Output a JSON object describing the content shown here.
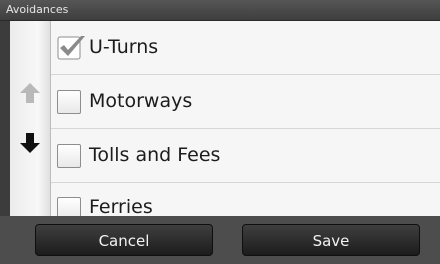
{
  "title": "Avoidances",
  "scroll": {
    "up_icon": "arrow-up-icon",
    "down_icon": "arrow-down-icon",
    "up_enabled": false,
    "down_enabled": true
  },
  "items": [
    {
      "label": "U-Turns",
      "checked": true
    },
    {
      "label": "Motorways",
      "checked": false
    },
    {
      "label": "Tolls and Fees",
      "checked": false
    },
    {
      "label": "Ferries",
      "checked": false
    }
  ],
  "buttons": {
    "cancel_label": "Cancel",
    "save_label": "Save"
  },
  "colors": {
    "checkmark": "#8a8a8a",
    "up_arrow_disabled": "#b9b9b9",
    "down_arrow": "#111111"
  }
}
